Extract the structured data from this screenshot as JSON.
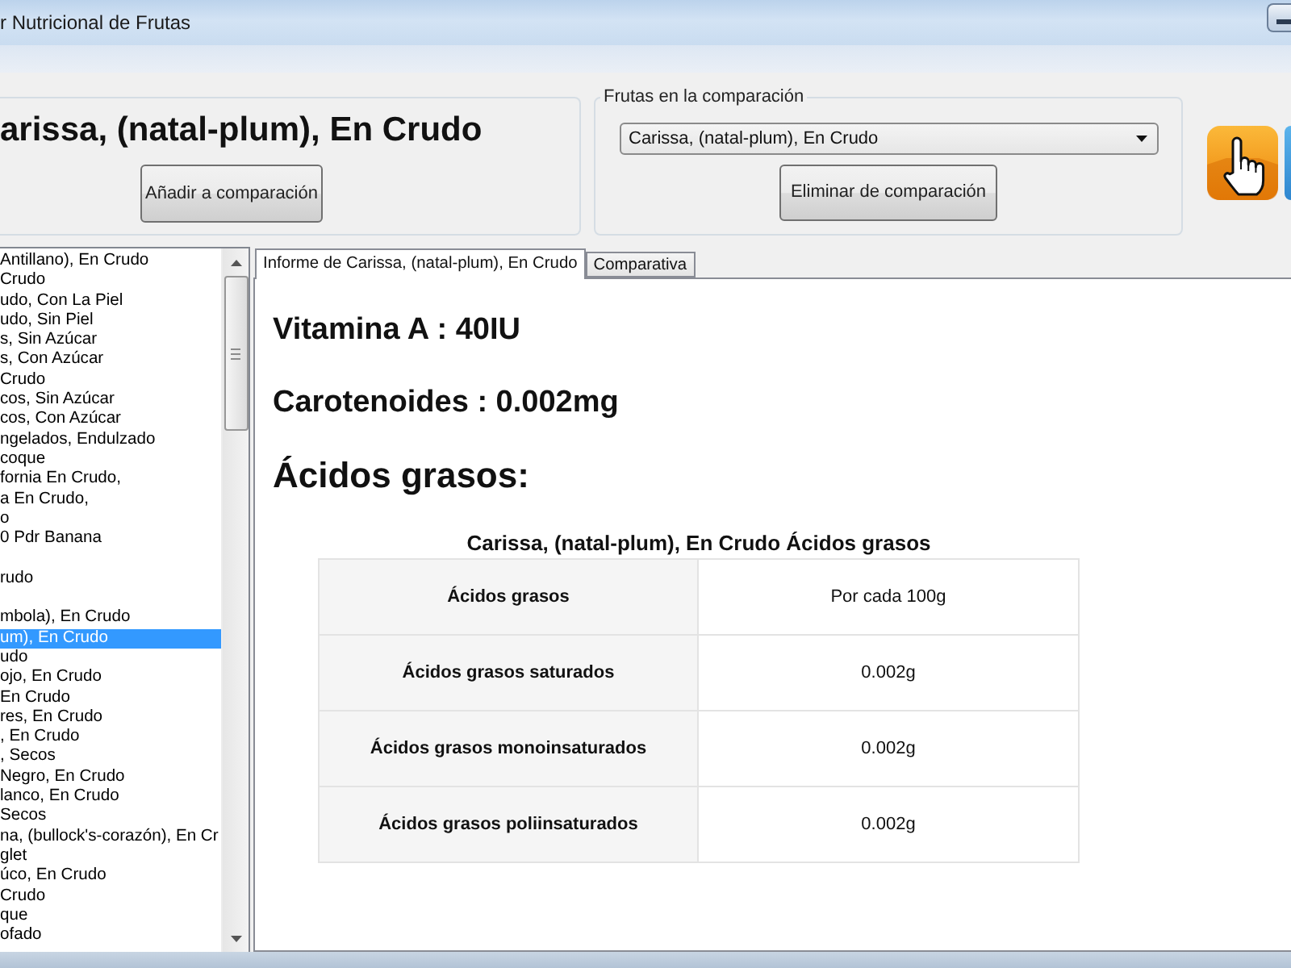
{
  "window": {
    "title": "r Nutricional de Frutas"
  },
  "fruit_panel": {
    "name": "arissa, (natal-plum), En Crudo",
    "add_button": "Añadir a comparación"
  },
  "comparison_panel": {
    "label": "Frutas en la comparación",
    "selected_fruit": "Carissa, (natal-plum), En Crudo",
    "remove_button": "Eliminar de comparación"
  },
  "fruit_list": {
    "items": [
      {
        "label": "Antillano), En Crudo",
        "selected": false
      },
      {
        "label": "Crudo",
        "selected": false
      },
      {
        "label": "udo, Con La Piel",
        "selected": false
      },
      {
        "label": "udo, Sin Piel",
        "selected": false
      },
      {
        "label": "s, Sin Azúcar",
        "selected": false
      },
      {
        "label": "s, Con Azúcar",
        "selected": false
      },
      {
        "label": "Crudo",
        "selected": false
      },
      {
        "label": "cos, Sin Azúcar",
        "selected": false
      },
      {
        "label": "cos, Con Azúcar",
        "selected": false
      },
      {
        "label": "ngelados, Endulzado",
        "selected": false
      },
      {
        "label": "coque",
        "selected": false
      },
      {
        "label": "fornia En Crudo,",
        "selected": false
      },
      {
        "label": "a En Crudo,",
        "selected": false
      },
      {
        "label": "o",
        "selected": false
      },
      {
        "label": "0 Pdr Banana",
        "selected": false
      },
      {
        "selected": false
      },
      {
        "label": "rudo",
        "selected": false
      },
      {
        "selected": false
      },
      {
        "label": "mbola), En Crudo",
        "selected": false
      },
      {
        "label": "um), En Crudo",
        "selected": true
      },
      {
        "label": "udo",
        "selected": false
      },
      {
        "label": "ojo, En Crudo",
        "selected": false
      },
      {
        "label": "En Crudo",
        "selected": false
      },
      {
        "label": "res, En Crudo",
        "selected": false
      },
      {
        "label": ", En Crudo",
        "selected": false
      },
      {
        "label": ", Secos",
        "selected": false
      },
      {
        "label": "Negro, En Crudo",
        "selected": false
      },
      {
        "label": "lanco, En Crudo",
        "selected": false
      },
      {
        "label": "Secos",
        "selected": false
      },
      {
        "label": "na, (bullock's-corazón), En Cr",
        "selected": false
      },
      {
        "label": "glet",
        "selected": false
      },
      {
        "label": "úco, En Crudo",
        "selected": false
      },
      {
        "label": "Crudo",
        "selected": false
      },
      {
        "label": "que",
        "selected": false
      },
      {
        "label": "ofado",
        "selected": false
      }
    ]
  },
  "tabs": [
    {
      "label": "Informe de Carissa, (natal-plum), En Crudo",
      "selected": true
    },
    {
      "label": "Comparativa",
      "selected": false
    }
  ],
  "report": {
    "nutrients": [
      "Vitamina A : 40IU",
      "Carotenoides : 0.002mg"
    ],
    "section_heading": "Ácidos grasos:",
    "table": {
      "caption": "Carissa, (natal-plum), En Crudo Ácidos grasos",
      "columns": [
        "Ácidos grasos",
        "Por cada 100g"
      ],
      "rows": [
        [
          "Ácidos grasos saturados",
          "0.002g"
        ],
        [
          "Ácidos grasos monoinsaturados",
          "0.002g"
        ],
        [
          "Ácidos grasos poliinsaturados",
          "0.002g"
        ]
      ]
    }
  }
}
